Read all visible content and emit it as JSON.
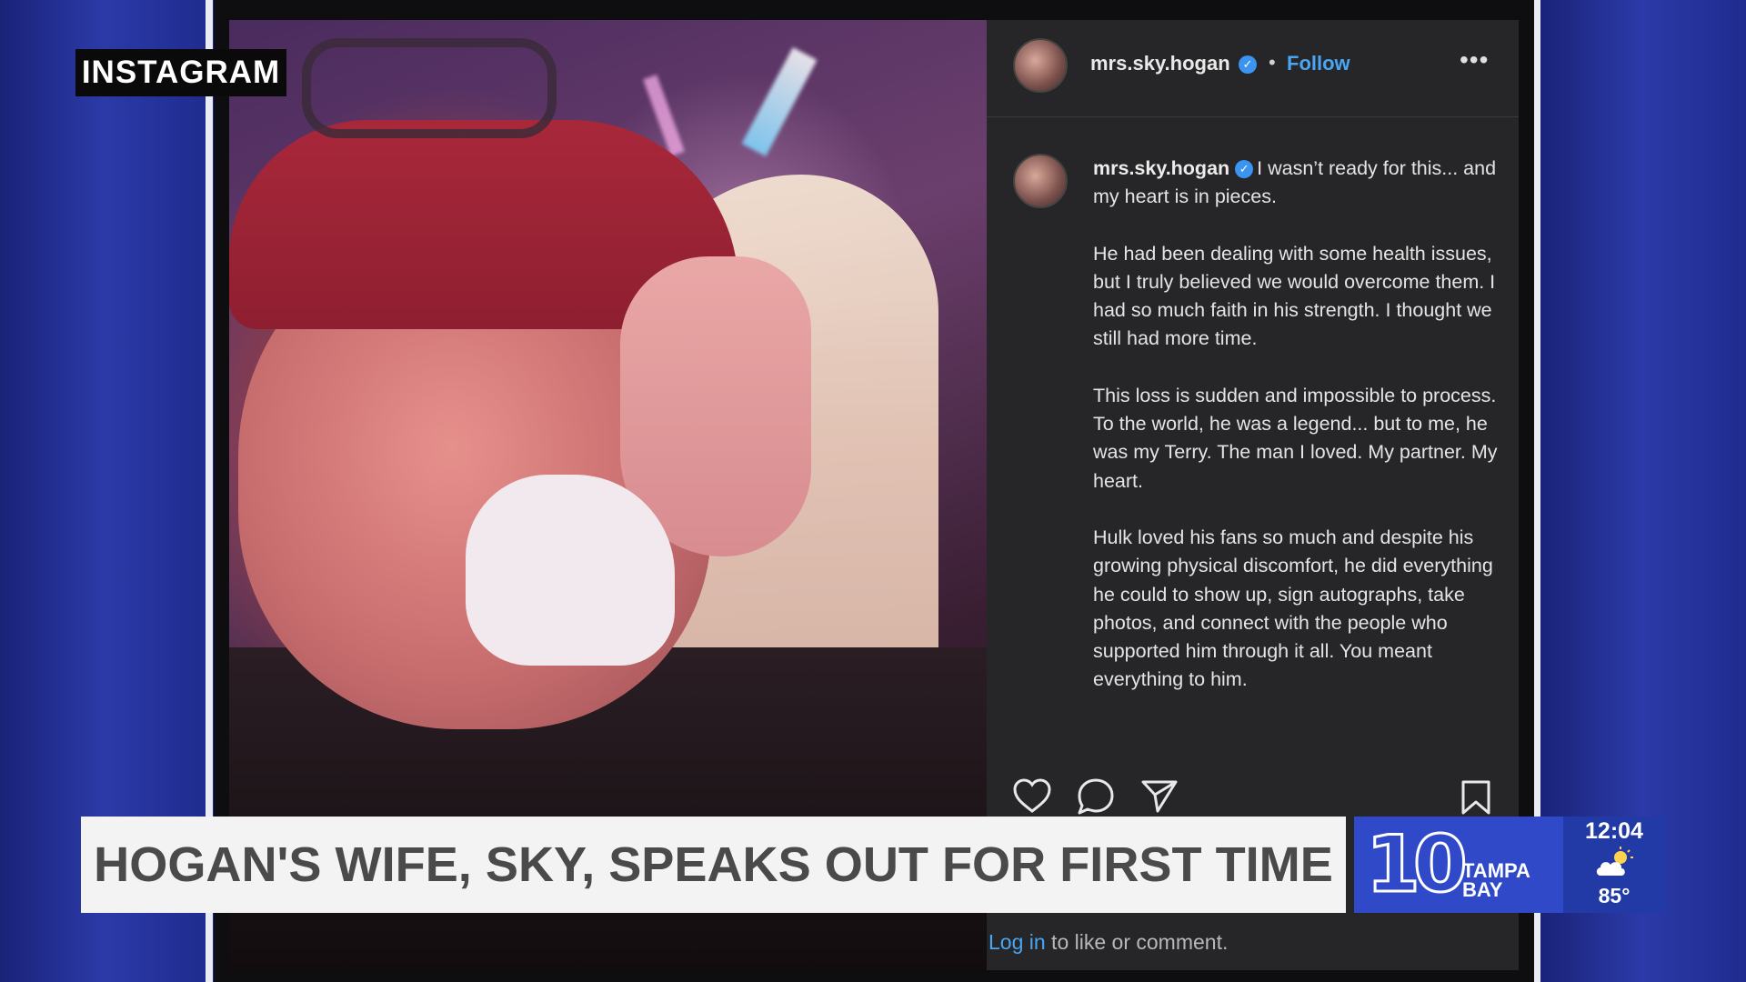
{
  "broadcast": {
    "source_tag": "INSTAGRAM",
    "headline": "HOGAN'S WIFE, SKY, SPEAKS OUT FOR FIRST TIME",
    "station": {
      "number": "10",
      "name_top": "TAMPA",
      "name_bottom": "BAY",
      "time": "12:04",
      "temperature": "85°",
      "weather_icon": "partly-cloudy-icon"
    }
  },
  "post": {
    "header": {
      "username": "mrs.sky.hogan",
      "verified_mark": "✓",
      "separator": "•",
      "follow_label": "Follow",
      "more_label": "•••"
    },
    "caption": {
      "username": "mrs.sky.hogan",
      "first_line": "I wasn’t ready for this... and my heart is in pieces.",
      "paragraphs": [
        "He had been dealing with some health issues, but I truly believed we would overcome them. I had so much faith in his strength. I thought we still had more time.",
        "This loss is sudden and impossible to process. To the world, he was a legend... but to me, he was my Terry. The man I loved. My partner. My heart.",
        "Hulk loved his fans so much and despite his growing physical discomfort, he did everything he could to show up, sign autographs, take photos, and connect with the people who supported him through it all. You meant everything to him."
      ]
    },
    "actions": [
      "heart-icon",
      "comment-icon",
      "share-icon",
      "bookmark-icon"
    ],
    "footer": {
      "login_link": "Log in",
      "login_rest": " to like or comment."
    }
  },
  "colors": {
    "side_blue": "#2b3aa8",
    "post_panel": "#262628",
    "link_blue": "#4aa6f2",
    "station_blue": "#2f49c9",
    "headline_bg": "#f3f3f3",
    "headline_text": "#4a4a4a"
  }
}
